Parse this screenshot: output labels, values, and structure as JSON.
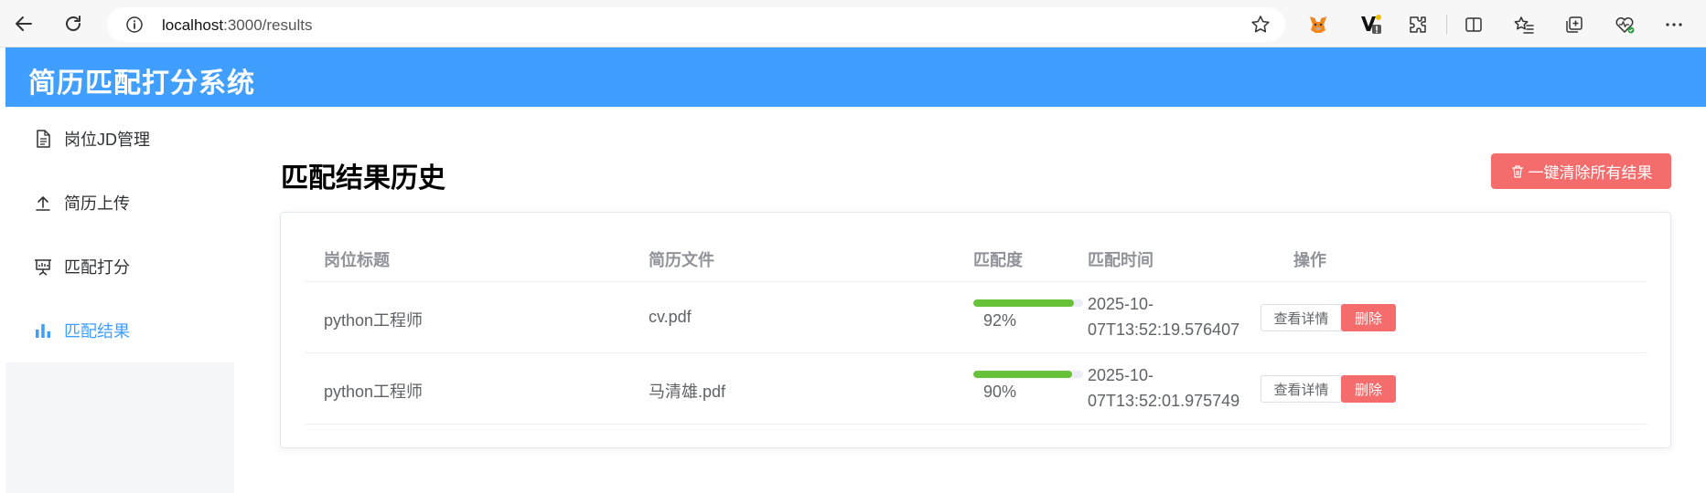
{
  "browser": {
    "url_host": "localhost",
    "url_path": ":3000/results"
  },
  "app": {
    "title": "简历匹配打分系统"
  },
  "sidebar": {
    "items": [
      {
        "label": "岗位JD管理",
        "icon": "document-icon",
        "active": false
      },
      {
        "label": "简历上传",
        "icon": "upload-icon",
        "active": false
      },
      {
        "label": "匹配打分",
        "icon": "presentation-icon",
        "active": false
      },
      {
        "label": "匹配结果",
        "icon": "bar-chart-icon",
        "active": true
      }
    ]
  },
  "main": {
    "title": "匹配结果历史",
    "clear_button": "一键清除所有结果",
    "table": {
      "headers": [
        "岗位标题",
        "简历文件",
        "匹配度",
        "匹配时间",
        "操作"
      ],
      "rows": [
        {
          "job": "python工程师",
          "file": "cv.pdf",
          "score": 92,
          "score_label": "92%",
          "time_line1": "2025-10-",
          "time_line2": "07T13:52:19.576407",
          "detail": "查看详情",
          "delete": "删除"
        },
        {
          "job": "python工程师",
          "file": "马清雄.pdf",
          "score": 90,
          "score_label": "90%",
          "time_line1": "2025-10-",
          "time_line2": "07T13:52:01.975749",
          "detail": "查看详情",
          "delete": "删除"
        }
      ]
    }
  },
  "colors": {
    "primary": "#409eff",
    "danger": "#f56c6c",
    "success": "#67c23a"
  }
}
